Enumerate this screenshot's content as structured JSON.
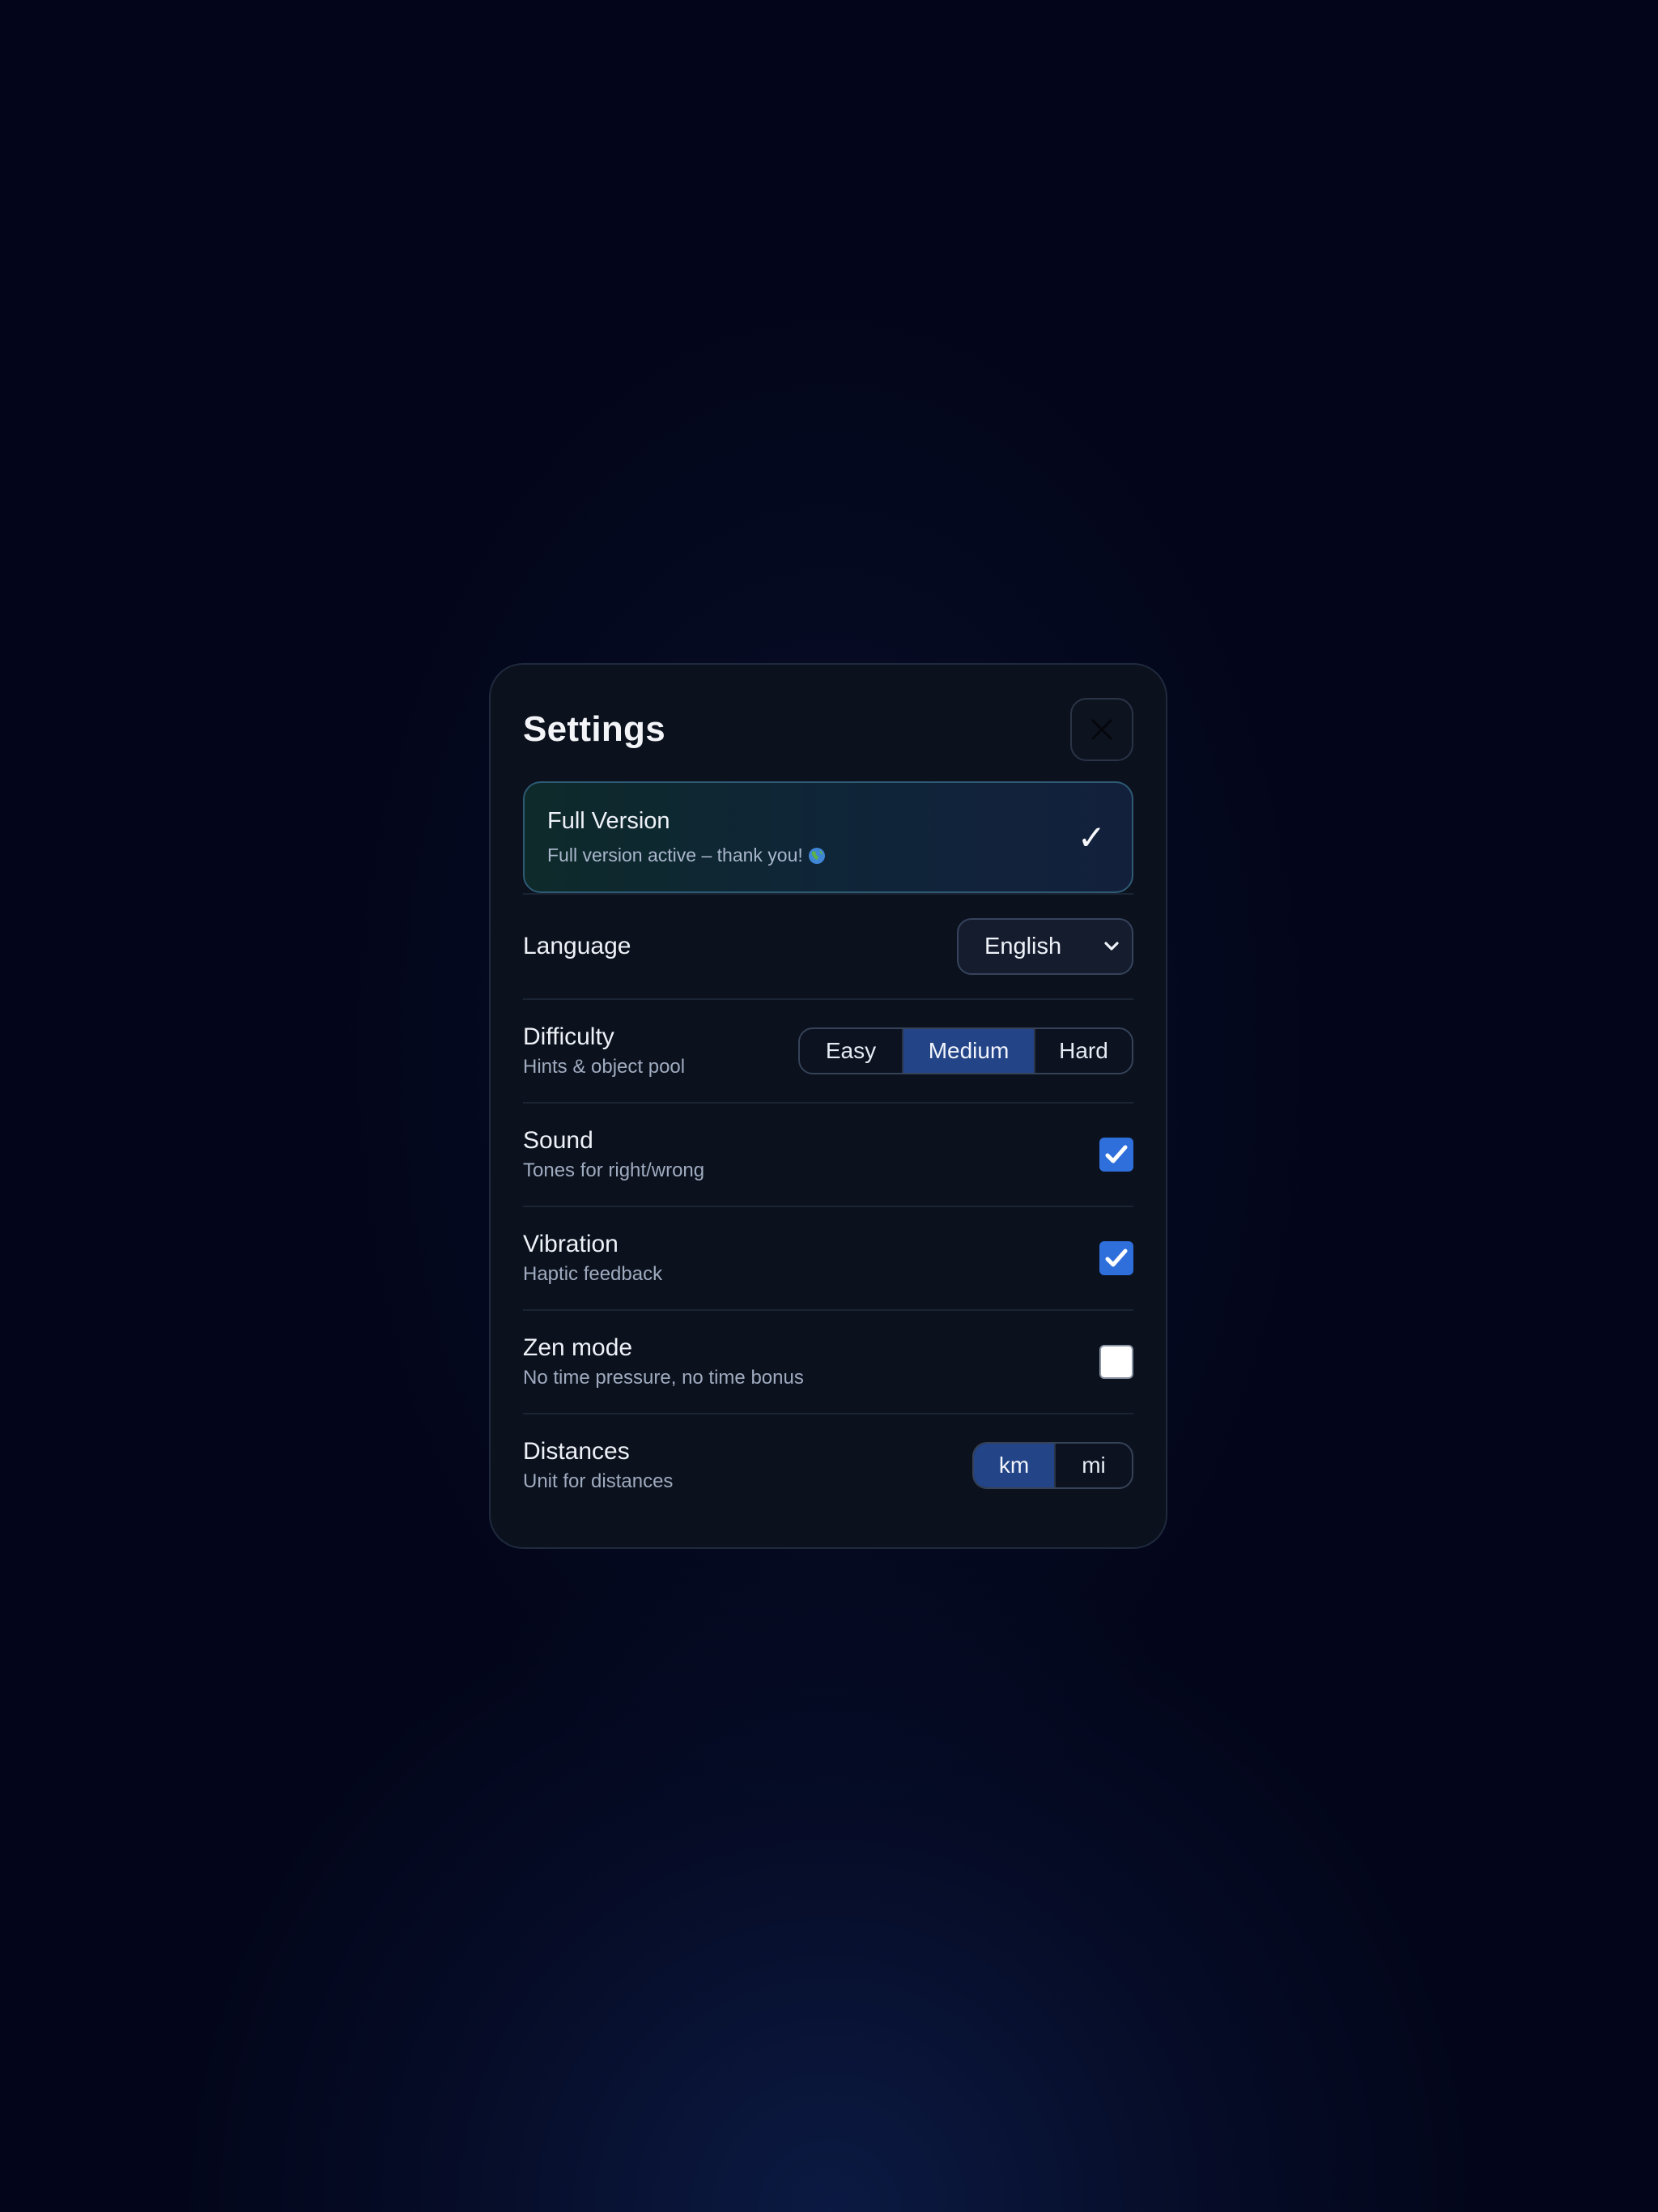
{
  "settings": {
    "title": "Settings",
    "full_version": {
      "title": "Full Version",
      "subtitle": "Full version active – thank you!",
      "check": "✓"
    },
    "language": {
      "label": "Language",
      "selected": "English"
    },
    "difficulty": {
      "label": "Difficulty",
      "sub": "Hints & object pool",
      "options": [
        "Easy",
        "Medium",
        "Hard"
      ],
      "selected": "Medium"
    },
    "sound": {
      "label": "Sound",
      "sub": "Tones for right/wrong",
      "checked": true
    },
    "vibration": {
      "label": "Vibration",
      "sub": "Haptic feedback",
      "checked": true
    },
    "zen": {
      "label": "Zen mode",
      "sub": "No time pressure, no time bonus",
      "checked": false
    },
    "distances": {
      "label": "Distances",
      "sub": "Unit for distances",
      "options": [
        "km",
        "mi"
      ],
      "selected": "km"
    }
  },
  "colors": {
    "accent": "#234487",
    "checkbox_on": "#2f6fdc"
  }
}
